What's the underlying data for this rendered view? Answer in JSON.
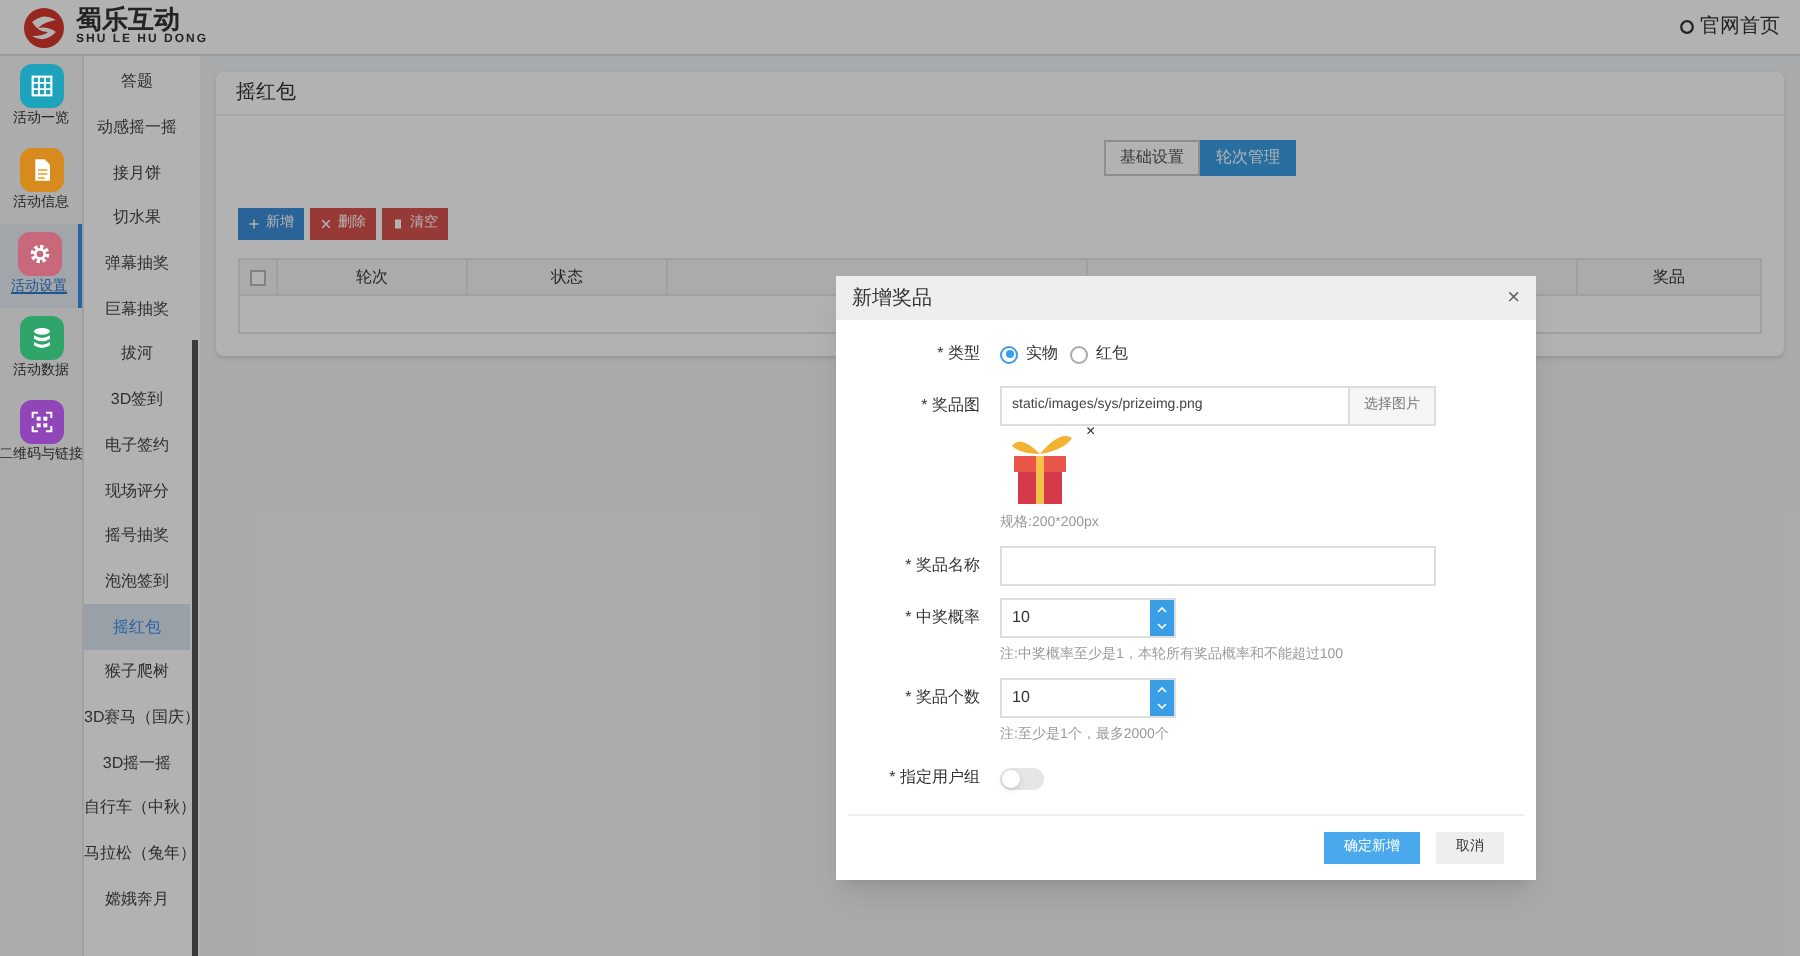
{
  "header": {
    "logo_title": "蜀乐互动",
    "logo_subtitle": "SHU LE HU DONG",
    "home_link": "官网首页"
  },
  "nav": [
    {
      "label": "活动一览",
      "kind": "grid",
      "color": "#1ea3bd",
      "selected": false
    },
    {
      "label": "活动信息",
      "kind": "document",
      "color": "#d78b1c",
      "selected": false
    },
    {
      "label": "活动设置",
      "kind": "gear",
      "color": "#c9677b",
      "selected": true
    },
    {
      "label": "活动数据",
      "kind": "database",
      "color": "#2fa56a",
      "selected": false
    },
    {
      "label": "二维码与链接",
      "kind": "qrcode",
      "color": "#9046b8",
      "selected": false
    }
  ],
  "games": [
    {
      "label": "答题",
      "selected": false
    },
    {
      "label": "动感摇一摇",
      "selected": false
    },
    {
      "label": "接月饼",
      "selected": false
    },
    {
      "label": "切水果",
      "selected": false
    },
    {
      "label": "弹幕抽奖",
      "selected": false
    },
    {
      "label": "巨幕抽奖",
      "selected": false
    },
    {
      "label": "拔河",
      "selected": false
    },
    {
      "label": "3D签到",
      "selected": false
    },
    {
      "label": "电子签约",
      "selected": false
    },
    {
      "label": "现场评分",
      "selected": false
    },
    {
      "label": "摇号抽奖",
      "selected": false
    },
    {
      "label": "泡泡签到",
      "selected": false
    },
    {
      "label": "摇红包",
      "selected": true
    },
    {
      "label": "猴子爬树",
      "selected": false
    },
    {
      "label": "3D赛马（国庆）",
      "selected": false
    },
    {
      "label": "3D摇一摇",
      "selected": false
    },
    {
      "label": "自行车（中秋）",
      "selected": false
    },
    {
      "label": "马拉松（兔年）",
      "selected": false
    },
    {
      "label": "嫦娥奔月",
      "selected": false
    }
  ],
  "panel": {
    "title": "摇红包",
    "tabs": [
      {
        "label": "基础设置",
        "selected": false
      },
      {
        "label": "轮次管理",
        "selected": true
      }
    ],
    "actions": [
      {
        "label": "新增",
        "kind": "add"
      },
      {
        "label": "删除",
        "kind": "delete"
      },
      {
        "label": "清空",
        "kind": "clear"
      }
    ],
    "table": {
      "select_all_checked": false,
      "columns": [
        "轮次",
        "状态",
        "奖品"
      ]
    }
  },
  "dialog": {
    "title": "新增奖品",
    "close": "×",
    "fields": [
      {
        "kind": "radio",
        "label": "* 类型",
        "options": [
          {
            "label": "实物",
            "selected": true
          },
          {
            "label": "红包",
            "selected": false
          }
        ]
      },
      {
        "kind": "image",
        "label": "* 奖品图",
        "value": "static/images/sys/prizeimg.png",
        "button": "选择图片",
        "remove": "×",
        "hint": "规格:200*200px"
      },
      {
        "kind": "text",
        "label": "* 奖品名称"
      },
      {
        "kind": "number",
        "label": "* 中奖概率",
        "value": "10",
        "hint": "注:中奖概率至少是1，本轮所有奖品概率和不能超过100"
      },
      {
        "kind": "number",
        "label": "* 奖品个数",
        "value": "10",
        "hint": "注:至少是1个，最多2000个"
      },
      {
        "kind": "switch",
        "label": "* 指定用户组",
        "on": false
      }
    ],
    "buttons": [
      {
        "label": "确定新增",
        "kind": "primary"
      },
      {
        "label": "取消",
        "kind": "default"
      }
    ]
  }
}
